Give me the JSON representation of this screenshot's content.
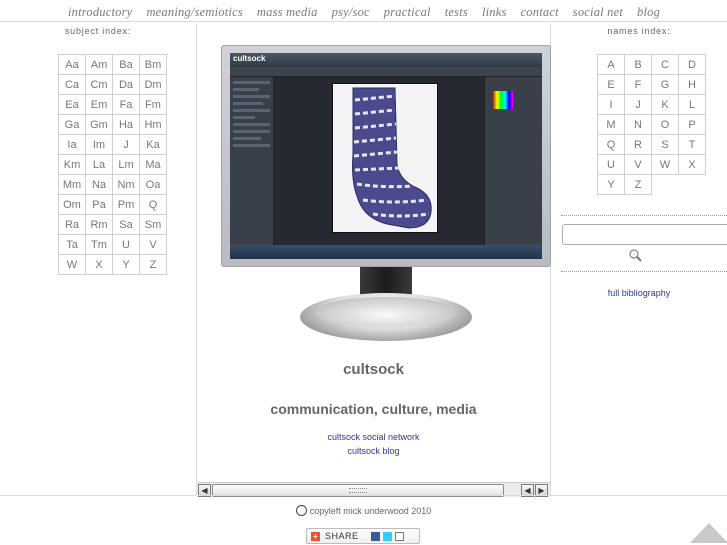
{
  "nav": {
    "items": [
      "introductory",
      "meaning/semiotics",
      "mass media",
      "psy/soc",
      "practical",
      "tests",
      "links",
      "contact",
      "social net",
      "blog"
    ]
  },
  "subject_index": {
    "title": "subject index:",
    "cells": [
      "Aa",
      "Am",
      "Ba",
      "Bm",
      "Ca",
      "Cm",
      "Da",
      "Dm",
      "Ea",
      "Em",
      "Fa",
      "Fm",
      "Ga",
      "Gm",
      "Ha",
      "Hm",
      "Ia",
      "Im",
      "J",
      "Ka",
      "Km",
      "La",
      "Lm",
      "Ma",
      "Mm",
      "Na",
      "Nm",
      "Oa",
      "Om",
      "Pa",
      "Pm",
      "Q",
      "Ra",
      "Rm",
      "Sa",
      "Sm",
      "Ta",
      "Tm",
      "U",
      "V",
      "W",
      "X",
      "Y",
      "Z"
    ]
  },
  "names_index": {
    "title": "names index:",
    "cells": [
      "A",
      "B",
      "C",
      "D",
      "E",
      "F",
      "G",
      "H",
      "I",
      "J",
      "K",
      "L",
      "M",
      "N",
      "O",
      "P",
      "Q",
      "R",
      "S",
      "T",
      "U",
      "V",
      "W",
      "X",
      "Y",
      "Z"
    ]
  },
  "search": {
    "value": "",
    "button_icon": "magnifier-icon"
  },
  "bibliography_link": "full bibliography",
  "monitor": {
    "screen_logo": "cultsock"
  },
  "site_title": "cultsock",
  "tagline": "communication, culture, media",
  "links": {
    "social": "cultsock social network",
    "blog": "cultsock blog"
  },
  "footer": {
    "copyleft": "copyleft mick underwood 2010",
    "share_label": "SHARE"
  },
  "colors": {
    "link": "#2b3a8f",
    "nav": "#7a7a7a",
    "border": "#cfcfcf"
  }
}
